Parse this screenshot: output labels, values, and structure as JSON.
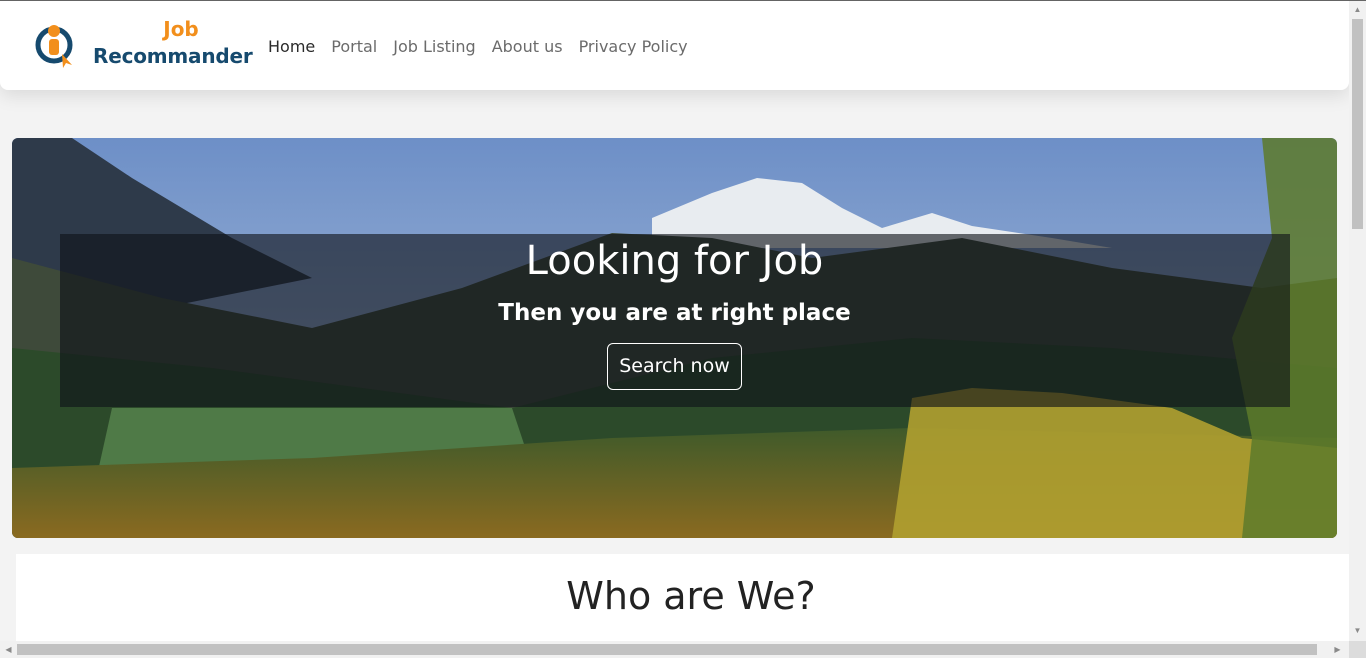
{
  "brand": {
    "line1": "Job",
    "line2": "Recommander",
    "colors": {
      "orange": "#f28f1c",
      "navy": "#164a6e"
    }
  },
  "nav": {
    "items": [
      {
        "label": "Home",
        "active": true
      },
      {
        "label": "Portal",
        "active": false
      },
      {
        "label": "Job Listing",
        "active": false
      },
      {
        "label": "About us",
        "active": false
      },
      {
        "label": "Privacy Policy",
        "active": false
      }
    ]
  },
  "hero": {
    "title": "Looking for Job",
    "subtitle": "Then you are at right place",
    "button_label": "Search now",
    "background": "mountain-forest-landscape"
  },
  "about": {
    "title": "Who are We?"
  },
  "scrollbars": {
    "vertical_icon_up": "triangle-up-icon",
    "vertical_icon_down": "triangle-down-icon",
    "horizontal_icon_left": "triangle-left-icon",
    "horizontal_icon_right": "triangle-right-icon"
  }
}
